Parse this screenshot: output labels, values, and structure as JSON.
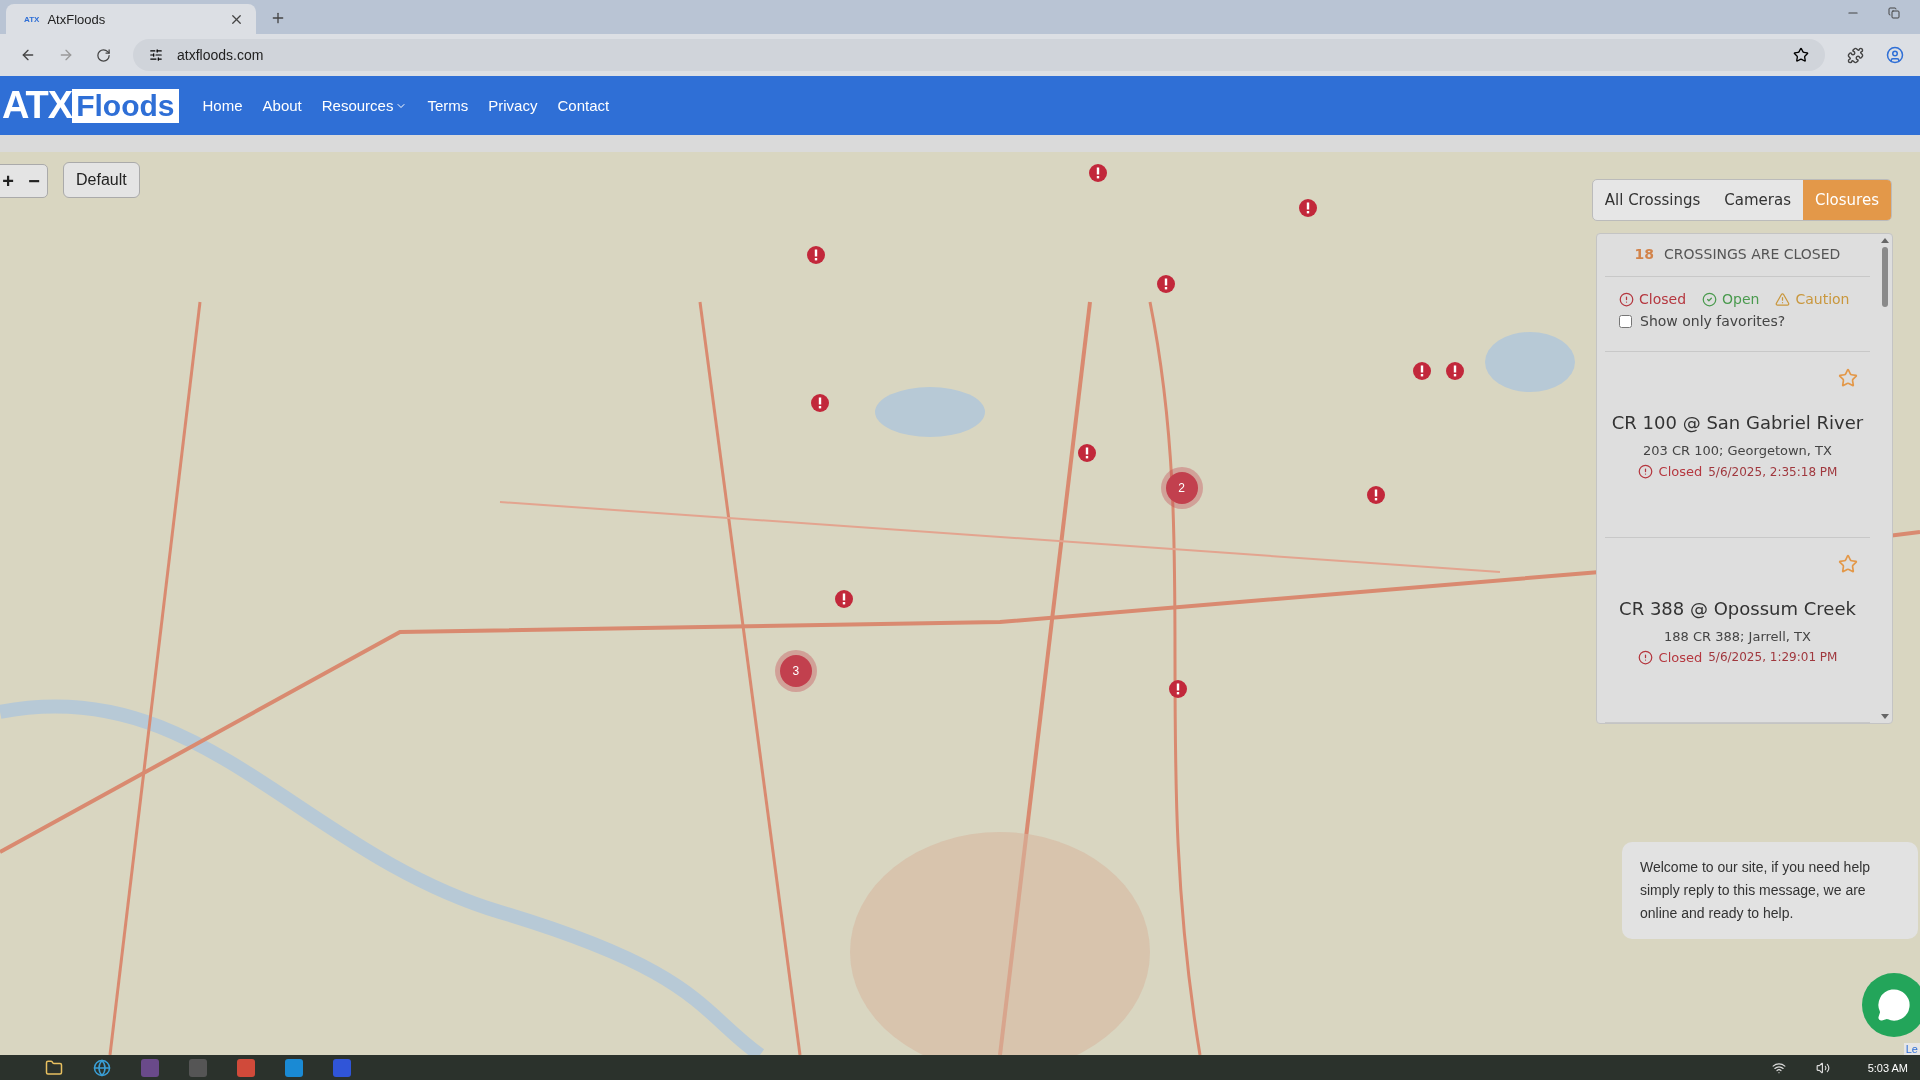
{
  "browser": {
    "tab": {
      "favicon": "ATX",
      "title": "AtxFloods"
    },
    "address": "atxfloods.com"
  },
  "navbar": {
    "logo": {
      "part_1": "ATX",
      "part_2": "Floods"
    },
    "links": [
      {
        "label": "Home",
        "dropdown": false
      },
      {
        "label": "About",
        "dropdown": false
      },
      {
        "label": "Resources",
        "dropdown": true
      },
      {
        "label": "Terms",
        "dropdown": false
      },
      {
        "label": "Privacy",
        "dropdown": false
      },
      {
        "label": "Contact",
        "dropdown": false
      }
    ]
  },
  "map": {
    "zoom_in": "+",
    "zoom_out": "−",
    "default_button": "Default",
    "markers": [
      {
        "kind": "pin"
      },
      {
        "kind": "pin"
      },
      {
        "kind": "pin"
      },
      {
        "kind": "pin"
      },
      {
        "kind": "pin"
      },
      {
        "kind": "pin"
      },
      {
        "kind": "pin"
      },
      {
        "kind": "pin"
      },
      {
        "kind": "pin"
      },
      {
        "kind": "pin"
      },
      {
        "kind": "pin"
      },
      {
        "kind": "cluster",
        "count": "2"
      },
      {
        "kind": "cluster",
        "count": "3"
      }
    ],
    "attribution": "Le"
  },
  "view_tabs": [
    {
      "label": "All Crossings",
      "selected": false
    },
    {
      "label": "Cameras",
      "selected": false
    },
    {
      "label": "Closures",
      "selected": true
    }
  ],
  "panel": {
    "count": "18",
    "heading": "CROSSINGS ARE CLOSED",
    "legend": [
      {
        "kind": "closed",
        "label": "Closed",
        "color": "#b5373f"
      },
      {
        "kind": "open",
        "label": "Open",
        "color": "#4a9a4e"
      },
      {
        "kind": "caution",
        "label": "Caution",
        "color": "#c9973d"
      }
    ],
    "favorites_filter": {
      "label": "Show only favorites?",
      "checked": false
    },
    "crossings": [
      {
        "name": "CR 100 @ San Gabriel River",
        "address": "203 CR 100; Georgetown, TX",
        "status": "Closed",
        "kind": "closed",
        "time": "5/6/2025, 2:35:18 PM",
        "favorite": false
      },
      {
        "name": "CR 388 @ Opossum Creek",
        "address": "188 CR 388; Jarrell, TX",
        "status": "Closed",
        "kind": "closed",
        "time": "5/6/2025, 1:29:01 PM",
        "favorite": false
      }
    ]
  },
  "chat": {
    "message": "Welcome to our site, if you need help simply reply to this message, we are online and ready to help."
  },
  "taskbar": {
    "time": "5:03 AM"
  }
}
